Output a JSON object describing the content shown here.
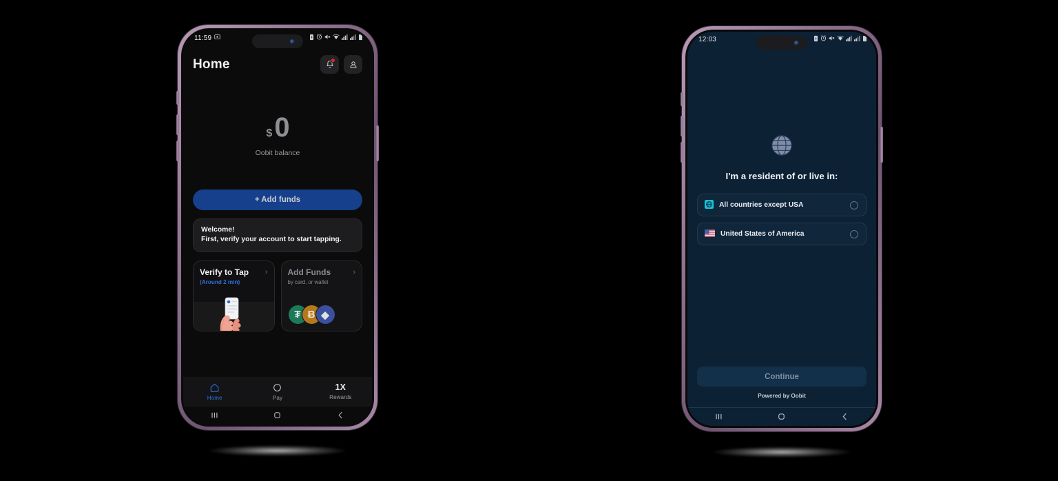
{
  "left_phone": {
    "status_bar": {
      "time": "11:59",
      "left_icons": [
        "screenshot-icon"
      ],
      "right_icons": [
        "battery-saver-icon",
        "alarm-icon",
        "mute-icon",
        "wifi-icon",
        "signal-icon",
        "signal-secondary-icon",
        "battery-icon"
      ]
    },
    "header": {
      "title": "Home",
      "notification_icon": "bell-icon",
      "profile_icon": "person-icon",
      "has_notification_badge": true
    },
    "balance": {
      "currency": "$",
      "value": "0",
      "label": "Oobit balance"
    },
    "add_funds_button": "+ Add funds",
    "welcome_card": {
      "line1": "Welcome!",
      "line2": "First, verify your account to start tapping."
    },
    "tiles": [
      {
        "title": "Verify to Tap",
        "eta": "(Around 2 min)",
        "chevron": "›",
        "illustration": "hand-holding-phone-illustration"
      },
      {
        "title": "Add Funds",
        "subtitle": "by card, or wallet",
        "chevron": "›",
        "coins": [
          {
            "name": "tether-coin-icon",
            "symbol": "₮",
            "color": "#1d7a58"
          },
          {
            "name": "bitcoin-coin-icon",
            "symbol": "Ƀ",
            "color": "#b5781c"
          },
          {
            "name": "ethereum-coin-icon",
            "symbol": "◆",
            "color": "#3b4f9e"
          }
        ]
      }
    ],
    "tabbar": [
      {
        "label": "Home",
        "icon": "home-icon",
        "active": true
      },
      {
        "label": "Pay",
        "icon": "circle-icon",
        "active": false
      },
      {
        "label": "Rewards",
        "icon": "1X",
        "active": false
      }
    ],
    "system_nav": [
      "recents-icon",
      "home-circle-icon",
      "back-icon"
    ]
  },
  "right_phone": {
    "status_bar": {
      "time": "12:03",
      "right_icons": [
        "battery-saver-icon",
        "alarm-icon",
        "mute-icon",
        "wifi-icon",
        "signal-icon",
        "signal-secondary-icon",
        "battery-icon"
      ]
    },
    "globe_icon": "globe-icon",
    "heading": "I'm a resident of or live in:",
    "options": [
      {
        "label": "All countries except USA",
        "flag": "globe-flag-icon",
        "selected": false
      },
      {
        "label": "United States of America",
        "flag": "usa-flag-icon",
        "selected": false
      }
    ],
    "continue_button": "Continue",
    "powered_by": "Powered by Oobit",
    "system_nav": [
      "recents-icon",
      "home-circle-icon",
      "back-icon"
    ]
  },
  "colors": {
    "accent_blue": "#2f6fdb",
    "button_blue": "#17408c",
    "navy_bg": "#0d2134",
    "dark_bg": "#0b0b0b",
    "frame": "#9b7f9b",
    "badge_red": "#e0262b"
  }
}
